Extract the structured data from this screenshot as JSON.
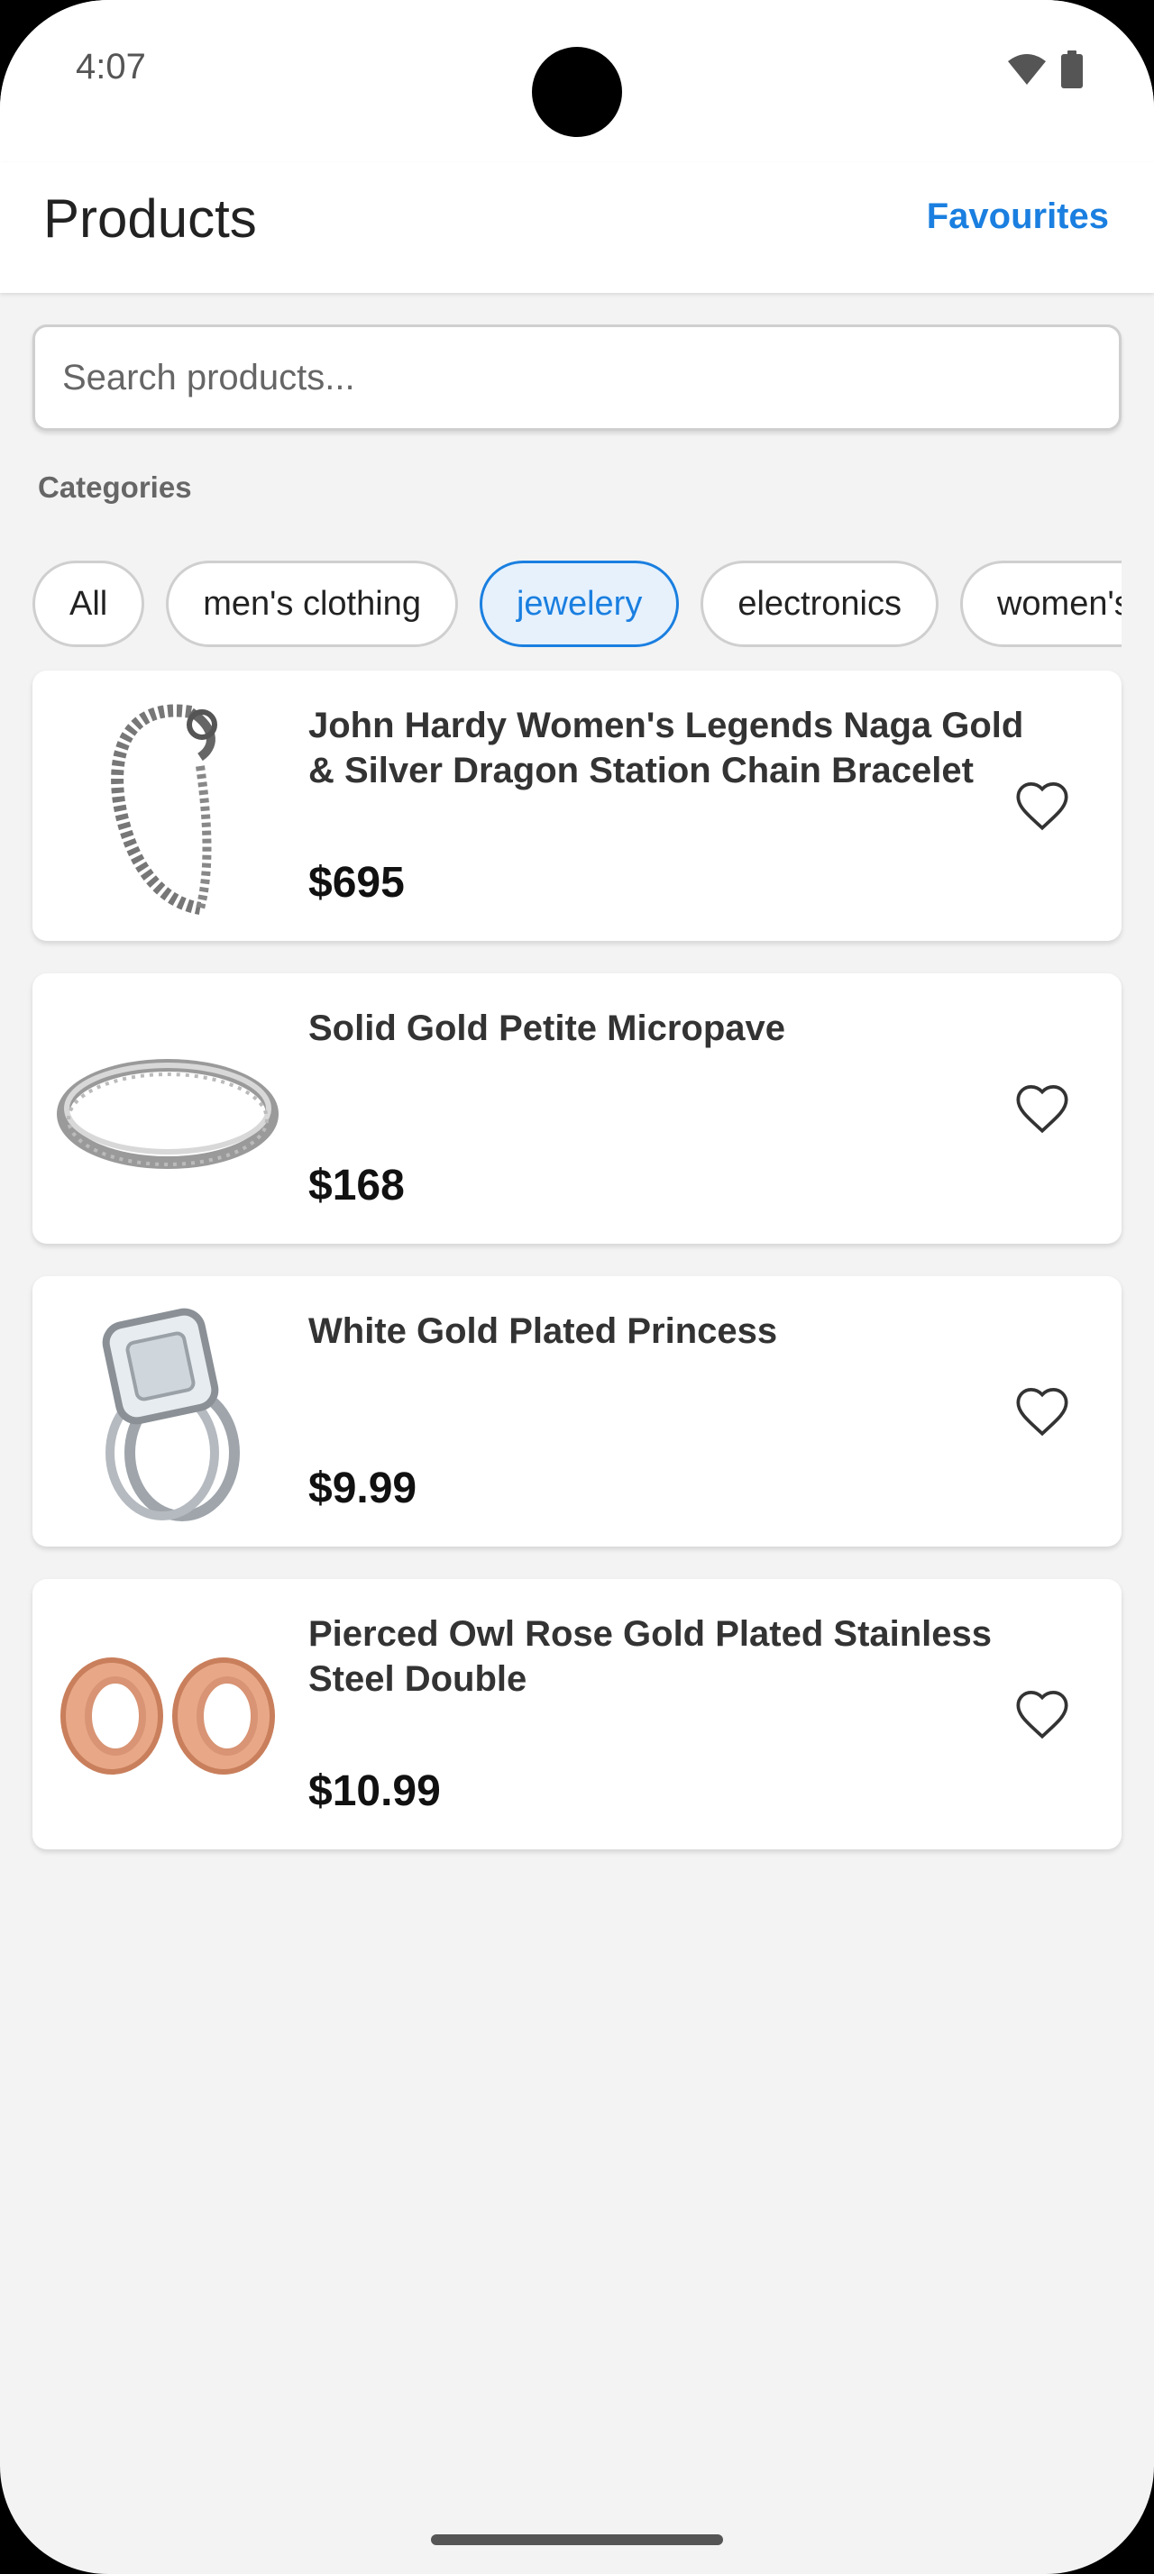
{
  "status_bar": {
    "time": "4:07",
    "icons": [
      "wifi-icon",
      "battery-icon"
    ]
  },
  "app_bar": {
    "title": "Products",
    "favourites_label": "Favourites"
  },
  "search": {
    "placeholder": "Search products...",
    "value": ""
  },
  "categories": {
    "label": "Categories",
    "chips": [
      {
        "label": "All",
        "active": false
      },
      {
        "label": "men's clothing",
        "active": false
      },
      {
        "label": "jewelery",
        "active": true
      },
      {
        "label": "electronics",
        "active": false
      },
      {
        "label": "women's clothing",
        "active": false
      }
    ]
  },
  "products": [
    {
      "title": "John Hardy Women's Legends Naga Gold & Silver Dragon Station Chain Bracelet",
      "price": "$695",
      "image": "silver-chain-bracelet",
      "favourite": false
    },
    {
      "title": "Solid Gold Petite Micropave",
      "price": "$168",
      "image": "silver-band-ring",
      "favourite": false
    },
    {
      "title": "White Gold Plated Princess",
      "price": "$9.99",
      "image": "diamond-engagement-ring",
      "favourite": false
    },
    {
      "title": "Pierced Owl Rose Gold Plated Stainless Steel Double",
      "price": "$10.99",
      "image": "rose-gold-tunnel-plugs",
      "favourite": false
    }
  ],
  "colors": {
    "accent": "#1a7fe0",
    "background": "#f3f3f3",
    "surface": "#ffffff"
  }
}
